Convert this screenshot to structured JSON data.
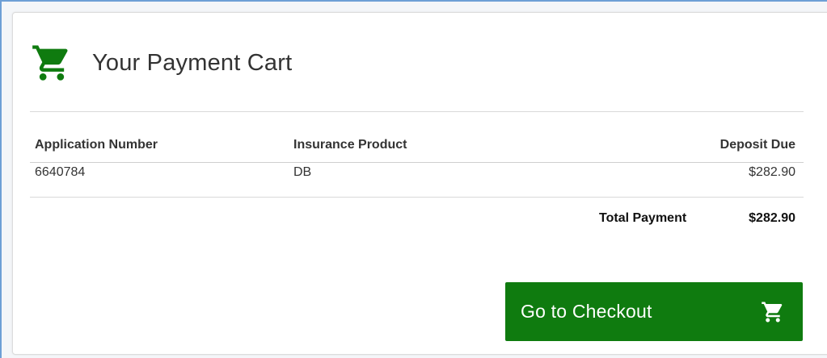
{
  "cart": {
    "title": "Your Payment Cart",
    "icon": "shopping-cart-icon",
    "accent_color": "#0f7b0f"
  },
  "table": {
    "headers": [
      "Application Number",
      "Insurance Product",
      "Deposit Due"
    ],
    "rows": [
      [
        "6640784",
        "DB",
        "$282.90"
      ]
    ]
  },
  "total": {
    "label": "Total Payment",
    "value": "$282.90"
  },
  "checkout": {
    "label": "Go to Checkout",
    "icon": "shopping-cart-icon"
  }
}
